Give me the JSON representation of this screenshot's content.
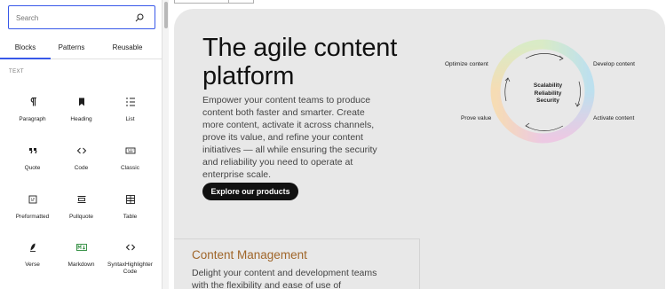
{
  "inserter": {
    "search_placeholder": "Search",
    "tabs": [
      {
        "label": "Blocks",
        "active": true
      },
      {
        "label": "Patterns",
        "active": false
      },
      {
        "label": "Reusable",
        "active": false
      }
    ],
    "section_label": "TEXT",
    "blocks": [
      {
        "label": "Paragraph",
        "icon": "paragraph-icon"
      },
      {
        "label": "Heading",
        "icon": "heading-icon"
      },
      {
        "label": "List",
        "icon": "list-icon"
      },
      {
        "label": "Quote",
        "icon": "quote-icon"
      },
      {
        "label": "Code",
        "icon": "code-icon"
      },
      {
        "label": "Classic",
        "icon": "keyboard-icon"
      },
      {
        "label": "Preformatted",
        "icon": "preformatted-icon"
      },
      {
        "label": "Pullquote",
        "icon": "pullquote-icon"
      },
      {
        "label": "Table",
        "icon": "table-icon"
      },
      {
        "label": "Verse",
        "icon": "verse-icon"
      },
      {
        "label": "Markdown",
        "icon": "markdown-icon"
      },
      {
        "label": "SyntaxHighlighter Code",
        "icon": "syntax-code-icon"
      }
    ],
    "accent_color": "#3858e9"
  },
  "hero": {
    "title": "The agile content platform",
    "body": "Empower your content teams to produce content both faster and smarter.  Create more content, activate it across channels, prove its value, and refine your content initiatives — all while ensuring the security and reliability you need to operate at enterprise scale.",
    "cta_label": "Explore our products",
    "cycle": {
      "labels": [
        "Optimize content",
        "Develop content",
        "Activate content",
        "Prove value"
      ],
      "center_lines": [
        "Scalability",
        "Reliability",
        "Security"
      ]
    }
  },
  "card": {
    "title": "Content Management",
    "body": "Delight your content and development teams with the flexibility and ease of use of"
  },
  "colors": {
    "hero_bg": "#e8e8e8",
    "cta_bg": "#111111",
    "card_title": "#a0662a"
  }
}
